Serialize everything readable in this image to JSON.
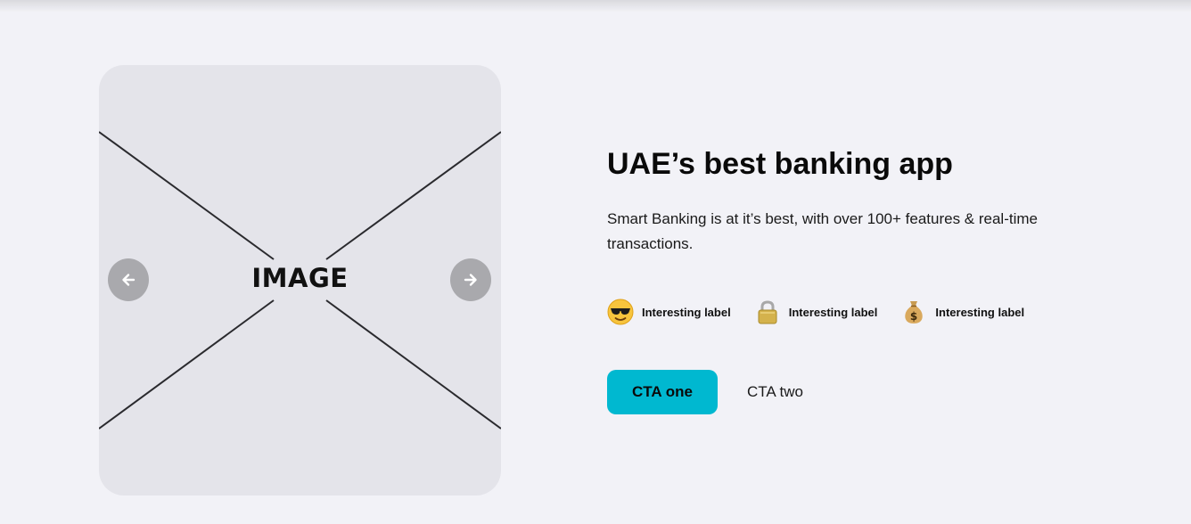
{
  "hero": {
    "image_placeholder": "IMAGE",
    "carousel": {
      "prev_icon": "arrow-left-icon",
      "next_icon": "arrow-right-icon"
    },
    "title": "UAE’s best banking app",
    "description": "Smart Banking is at it’s best, with over 100+ features & real-time transactions.",
    "features": [
      {
        "icon": "sunglasses-face-icon",
        "label": "Interesting label"
      },
      {
        "icon": "lock-icon",
        "label": "Interesting label"
      },
      {
        "icon": "money-bag-icon",
        "label": "Interesting label"
      }
    ],
    "cta_primary": "CTA one",
    "cta_secondary": "CTA two"
  },
  "colors": {
    "background": "#f2f2f7",
    "image_card": "#e4e4ea",
    "nav_button": "#a9a9ad",
    "cta_primary_bg": "#00b8d0"
  }
}
